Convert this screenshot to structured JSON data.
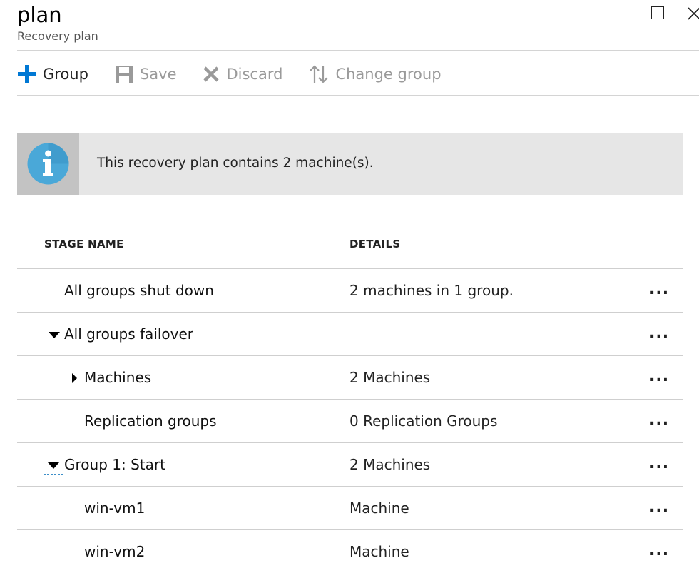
{
  "header": {
    "title": "plan",
    "subtitle": "Recovery plan"
  },
  "toolbar": {
    "group_label": "Group",
    "save_label": "Save",
    "discard_label": "Discard",
    "change_group_label": "Change group"
  },
  "banner": {
    "text": "This recovery plan contains 2 machine(s).",
    "icon": "info-icon"
  },
  "table": {
    "headers": {
      "name": "STAGE NAME",
      "details": "DETAILS"
    },
    "more_label": "...",
    "rows": [
      {
        "name": "All groups shut down",
        "details": "2 machines in 1 group.",
        "expander": "none"
      },
      {
        "name": "All groups failover",
        "details": "",
        "expander": "expanded"
      },
      {
        "name": "Machines",
        "details": "2 Machines",
        "expander": "collapsed"
      },
      {
        "name": "Replication groups",
        "details": "0 Replication Groups",
        "expander": "none"
      },
      {
        "name": "Group 1: Start",
        "details": "2 Machines",
        "expander": "expanded"
      },
      {
        "name": "win-vm1",
        "details": "Machine",
        "expander": "none"
      },
      {
        "name": "win-vm2",
        "details": "Machine",
        "expander": "none"
      }
    ]
  },
  "colors": {
    "accent": "#0078d4",
    "disabled_text": "#9a9a9a",
    "banner_bg": "#e6e6e6",
    "info_icon": "#4aa8d8"
  }
}
